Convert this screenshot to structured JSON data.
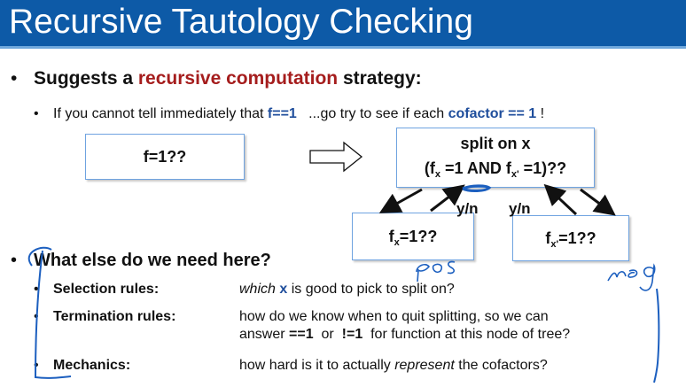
{
  "title": "Recursive Tautology Checking",
  "bullet1": {
    "dot": "•",
    "pre": "Suggests a ",
    "highlight": "recursive computation",
    "post": " strategy:"
  },
  "bullet2": {
    "dot": "•",
    "t1": "If you cannot tell immediately that ",
    "b1": "f==1",
    "t2": "   ...go try to see if each ",
    "b2": "cofactor == 1",
    "t3": " !"
  },
  "box_f": "f=1??",
  "box_split": {
    "line1": "split on x",
    "l2a": "(f",
    "sub1": "x",
    "l2b": " =1 AND f",
    "sub2": "x'",
    "l2c": " =1)??"
  },
  "box_fx": {
    "f": "f",
    "sub": "x",
    "rest": "=1??"
  },
  "box_fxn": {
    "f": "f",
    "sub": "x'",
    "rest": "=1??"
  },
  "yn_left": "y/n",
  "yn_right": "y/n",
  "bullet3": {
    "dot": "•",
    "text": "What else do we need here?"
  },
  "rows": [
    {
      "dot": "•",
      "label": "Selection rules:",
      "d1": "which ",
      "d2": "x",
      "d3": " is good to pick to split on?"
    },
    {
      "dot": "•",
      "label": "Termination rules:",
      "line1": "how do we know when to quit splitting, so we can",
      "l2a": "answer ",
      "l2b": "==1",
      "l2c": "  or  ",
      "l2d": "!=1",
      "l2e": "  for function at this node of tree?"
    },
    {
      "dot": "•",
      "label": "Mechanics:",
      "d1": "how hard is it to actually ",
      "d2": "represent",
      "d3": " the cofactors?"
    }
  ],
  "handwriting": {
    "left": "pos",
    "right": "neg"
  },
  "colors": {
    "title_bg": "#0d5aa7",
    "accent_red": "#a51d1d",
    "accent_blue": "#1f4e9c",
    "ink": "#1c5fbf"
  }
}
